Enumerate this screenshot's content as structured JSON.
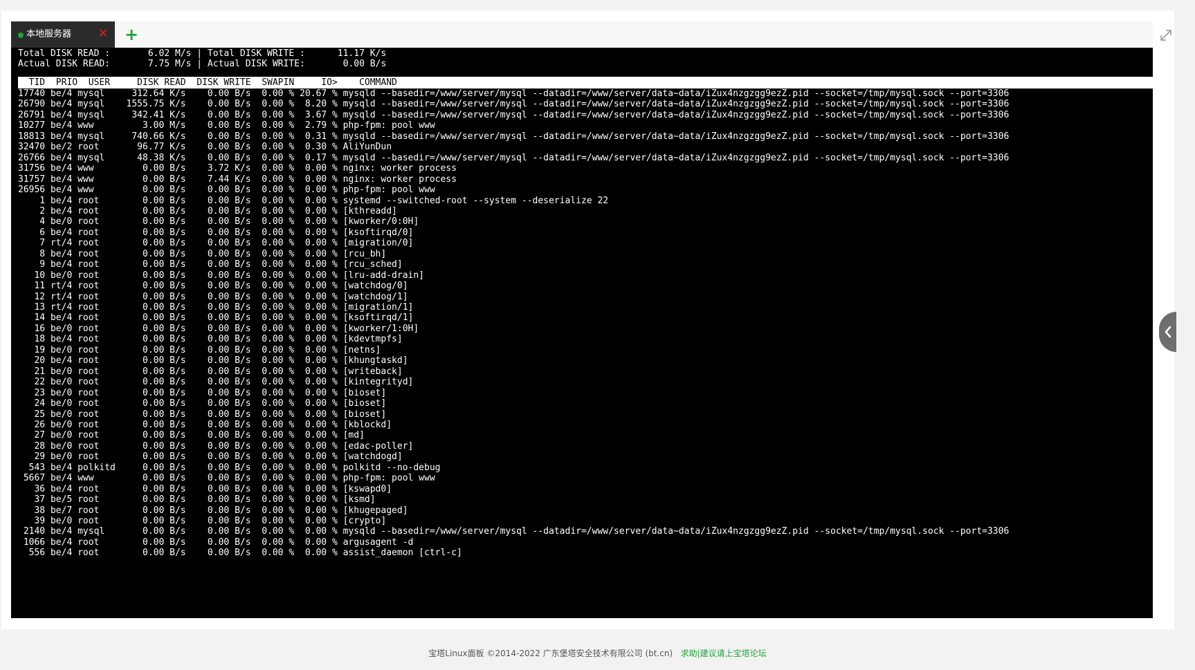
{
  "tabs": [
    {
      "label": "本地服务器",
      "status_color": "#20a53a",
      "close_glyph": "✕"
    }
  ],
  "add_tab_glyph": "+",
  "terminal": {
    "summary": [
      "Total DISK READ :       6.02 M/s | Total DISK WRITE :      11.17 K/s",
      "Actual DISK READ:       7.75 M/s | Actual DISK WRITE:       0.00 B/s"
    ],
    "header": "  TID  PRIO  USER     DISK READ  DISK WRITE  SWAPIN     IO>    COMMAND",
    "rows": [
      "17740 be/4 mysql     312.64 K/s    0.00 B/s  0.00 % 20.67 % mysqld --basedir=/www/server/mysql --datadir=/www/server/data~data/iZux4nzgzgg9ezZ.pid --socket=/tmp/mysql.sock --port=3306",
      "26790 be/4 mysql    1555.75 K/s    0.00 B/s  0.00 %  8.20 % mysqld --basedir=/www/server/mysql --datadir=/www/server/data~data/iZux4nzgzgg9ezZ.pid --socket=/tmp/mysql.sock --port=3306",
      "26791 be/4 mysql     342.41 K/s    0.00 B/s  0.00 %  3.67 % mysqld --basedir=/www/server/mysql --datadir=/www/server/data~data/iZux4nzgzgg9ezZ.pid --socket=/tmp/mysql.sock --port=3306",
      "10277 be/4 www         3.00 M/s    0.00 B/s  0.00 %  2.79 % php-fpm: pool www",
      "18813 be/4 mysql     740.66 K/s    0.00 B/s  0.00 %  0.31 % mysqld --basedir=/www/server/mysql --datadir=/www/server/data~data/iZux4nzgzgg9ezZ.pid --socket=/tmp/mysql.sock --port=3306",
      "32470 be/2 root       96.77 K/s    0.00 B/s  0.00 %  0.30 % AliYunDun",
      "26766 be/4 mysql      48.38 K/s    0.00 B/s  0.00 %  0.17 % mysqld --basedir=/www/server/mysql --datadir=/www/server/data~data/iZux4nzgzgg9ezZ.pid --socket=/tmp/mysql.sock --port=3306",
      "31756 be/4 www         0.00 B/s    3.72 K/s  0.00 %  0.00 % nginx: worker process",
      "31757 be/4 www         0.00 B/s    7.44 K/s  0.00 %  0.00 % nginx: worker process",
      "26956 be/4 www         0.00 B/s    0.00 B/s  0.00 %  0.00 % php-fpm: pool www",
      "    1 be/4 root        0.00 B/s    0.00 B/s  0.00 %  0.00 % systemd --switched-root --system --deserialize 22",
      "    2 be/4 root        0.00 B/s    0.00 B/s  0.00 %  0.00 % [kthreadd]",
      "    4 be/0 root        0.00 B/s    0.00 B/s  0.00 %  0.00 % [kworker/0:0H]",
      "    6 be/4 root        0.00 B/s    0.00 B/s  0.00 %  0.00 % [ksoftirqd/0]",
      "    7 rt/4 root        0.00 B/s    0.00 B/s  0.00 %  0.00 % [migration/0]",
      "    8 be/4 root        0.00 B/s    0.00 B/s  0.00 %  0.00 % [rcu_bh]",
      "    9 be/4 root        0.00 B/s    0.00 B/s  0.00 %  0.00 % [rcu_sched]",
      "   10 be/0 root        0.00 B/s    0.00 B/s  0.00 %  0.00 % [lru-add-drain]",
      "   11 rt/4 root        0.00 B/s    0.00 B/s  0.00 %  0.00 % [watchdog/0]",
      "   12 rt/4 root        0.00 B/s    0.00 B/s  0.00 %  0.00 % [watchdog/1]",
      "   13 rt/4 root        0.00 B/s    0.00 B/s  0.00 %  0.00 % [migration/1]",
      "   14 be/4 root        0.00 B/s    0.00 B/s  0.00 %  0.00 % [ksoftirqd/1]",
      "   16 be/0 root        0.00 B/s    0.00 B/s  0.00 %  0.00 % [kworker/1:0H]",
      "   18 be/4 root        0.00 B/s    0.00 B/s  0.00 %  0.00 % [kdevtmpfs]",
      "   19 be/0 root        0.00 B/s    0.00 B/s  0.00 %  0.00 % [netns]",
      "   20 be/4 root        0.00 B/s    0.00 B/s  0.00 %  0.00 % [khungtaskd]",
      "   21 be/0 root        0.00 B/s    0.00 B/s  0.00 %  0.00 % [writeback]",
      "   22 be/0 root        0.00 B/s    0.00 B/s  0.00 %  0.00 % [kintegrityd]",
      "   23 be/0 root        0.00 B/s    0.00 B/s  0.00 %  0.00 % [bioset]",
      "   24 be/0 root        0.00 B/s    0.00 B/s  0.00 %  0.00 % [bioset]",
      "   25 be/0 root        0.00 B/s    0.00 B/s  0.00 %  0.00 % [bioset]",
      "   26 be/0 root        0.00 B/s    0.00 B/s  0.00 %  0.00 % [kblockd]",
      "   27 be/0 root        0.00 B/s    0.00 B/s  0.00 %  0.00 % [md]",
      "   28 be/0 root        0.00 B/s    0.00 B/s  0.00 %  0.00 % [edac-poller]",
      "   29 be/0 root        0.00 B/s    0.00 B/s  0.00 %  0.00 % [watchdogd]",
      "  543 be/4 polkitd     0.00 B/s    0.00 B/s  0.00 %  0.00 % polkitd --no-debug",
      " 5667 be/4 www         0.00 B/s    0.00 B/s  0.00 %  0.00 % php-fpm: pool www",
      "   36 be/4 root        0.00 B/s    0.00 B/s  0.00 %  0.00 % [kswapd0]",
      "   37 be/5 root        0.00 B/s    0.00 B/s  0.00 %  0.00 % [ksmd]",
      "   38 be/7 root        0.00 B/s    0.00 B/s  0.00 %  0.00 % [khugepaged]",
      "   39 be/0 root        0.00 B/s    0.00 B/s  0.00 %  0.00 % [crypto]",
      " 2140 be/4 mysql       0.00 B/s    0.00 B/s  0.00 %  0.00 % mysqld --basedir=/www/server/mysql --datadir=/www/server/data~data/iZux4nzgzgg9ezZ.pid --socket=/tmp/mysql.sock --port=3306",
      " 1066 be/4 root        0.00 B/s    0.00 B/s  0.00 %  0.00 % argusagent -d",
      "  556 be/4 root        0.00 B/s    0.00 B/s  0.00 %  0.00 % assist_daemon [ctrl-c]"
    ]
  },
  "footer": {
    "copyright": "宝塔Linux面板 ©2014-2022 广东堡塔安全技术有限公司 (bt.cn)",
    "link": "求助|建议请上宝塔论坛",
    "link_color": "#20a53a"
  },
  "icons": {
    "fullscreen": "fullscreen-icon",
    "side_toggle": "chevron-left-icon"
  }
}
